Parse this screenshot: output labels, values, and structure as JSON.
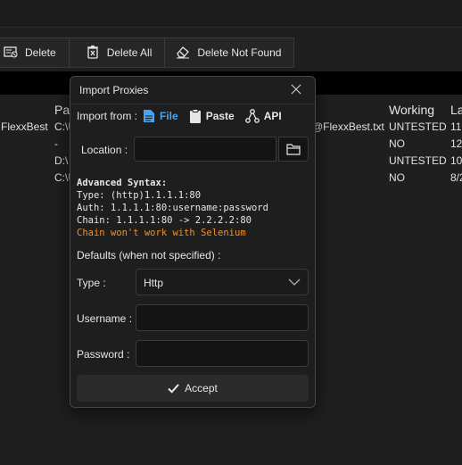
{
  "toolbar": {
    "delete": "Delete",
    "delete_all": "Delete All",
    "delete_not_found": "Delete Not Found"
  },
  "grid": {
    "columns": {
      "path": "Pat",
      "working": "Working",
      "last": "La"
    },
    "rows": [
      {
        "name": "FlexxBest",
        "path": "C:\\U",
        "file": "@FlexxBest.txt",
        "working": "UNTESTED",
        "last": "11"
      },
      {
        "name": "",
        "path": "-",
        "file": "",
        "working": "NO",
        "last": "12"
      },
      {
        "name": "",
        "path": "D:\\",
        "file": "",
        "working": "UNTESTED",
        "last": "10"
      },
      {
        "name": "",
        "path": "C:\\U",
        "file": "",
        "working": "NO",
        "last": "8/2"
      }
    ]
  },
  "dialog": {
    "title": "Import Proxies",
    "import_from": "Import from :",
    "sources": [
      {
        "label": "File",
        "active": true
      },
      {
        "label": "Paste",
        "active": false
      },
      {
        "label": "API",
        "active": false
      }
    ],
    "location_label": "Location :",
    "location_value": "",
    "syntax": {
      "header": "Advanced Syntax:",
      "type": "Type: (http)1.1.1.1:80",
      "auth": "Auth: 1.1.1.1:80:username:password",
      "chain": "Chain: 1.1.1.1:80 -> 2.2.2.2:80",
      "warning": "Chain won't work with Selenium"
    },
    "defaults_label": "Defaults (when not specified) :",
    "type_label": "Type :",
    "type_value": "Http",
    "username_label": "Username :",
    "username_value": "",
    "password_label": "Password :",
    "password_value": "",
    "accept": "Accept"
  },
  "colors": {
    "accent": "#4aa3f0",
    "warning": "#f0902a",
    "background": "#1f1f1f"
  }
}
